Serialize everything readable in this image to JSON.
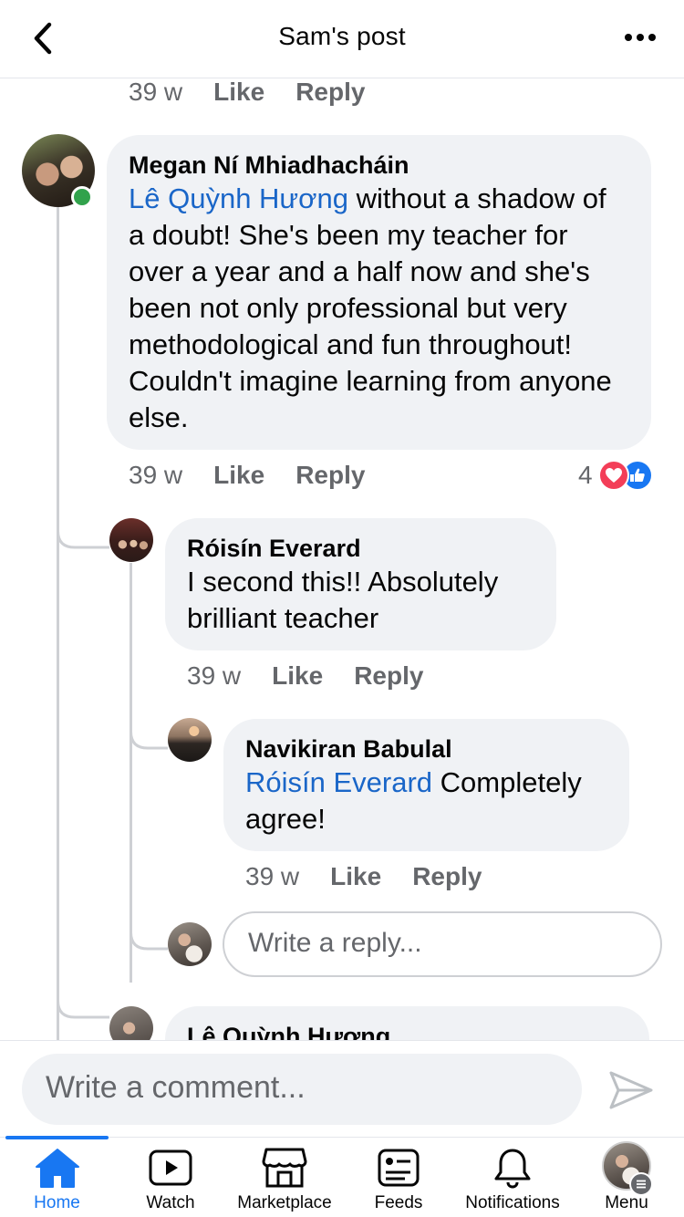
{
  "header": {
    "title": "Sam's post"
  },
  "top_comment_meta": {
    "time": "39 w",
    "like": "Like",
    "reply": "Reply"
  },
  "comments": [
    {
      "author": "Megan Ní Mhiadhacháin",
      "mention": "Lê Quỳnh Hương",
      "text": " without a shadow of a doubt! She's been my teacher for over a year and a half now and she's been not only professional but very methodological and fun throughout! Couldn't imagine learning from anyone else.",
      "time": "39 w",
      "like": "Like",
      "reply": "Reply",
      "reaction_count": "4",
      "online": true
    },
    {
      "author": "Róisín Everard",
      "text": "I second this!! Absolutely brilliant teacher",
      "time": "39 w",
      "like": "Like",
      "reply": "Reply"
    },
    {
      "author": "Navikiran Babulal",
      "mention": "Róisín Everard",
      "text": " Completely agree!",
      "time": "39 w",
      "like": "Like",
      "reply": "Reply"
    },
    {
      "author": "Lê Quỳnh Hương"
    }
  ],
  "reply_input": {
    "placeholder": "Write a reply..."
  },
  "composer": {
    "placeholder": "Write a comment..."
  },
  "tabs": [
    {
      "label": "Home",
      "icon": "home-icon",
      "active": true
    },
    {
      "label": "Watch",
      "icon": "watch-icon"
    },
    {
      "label": "Marketplace",
      "icon": "marketplace-icon"
    },
    {
      "label": "Feeds",
      "icon": "feeds-icon"
    },
    {
      "label": "Notifications",
      "icon": "bell-icon"
    },
    {
      "label": "Menu",
      "icon": "menu-avatar"
    }
  ],
  "colors": {
    "accent": "#1877f2",
    "mention": "#1a66c8",
    "bubble": "#f0f2f5",
    "muted": "#65676b",
    "online": "#31a24c",
    "love": "#f33e58"
  }
}
